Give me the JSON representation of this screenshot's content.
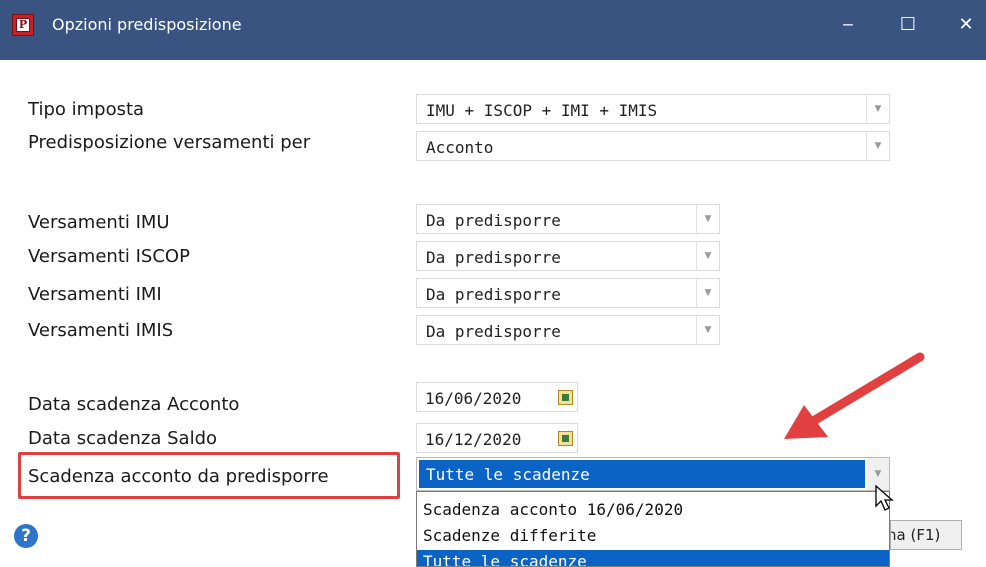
{
  "window": {
    "title": "Opzioni predisposizione",
    "app_icon_letter": "P",
    "minimize_glyph": "‒",
    "maximize_glyph": "☐",
    "close_glyph": "✕"
  },
  "form": {
    "tipo_imposta": {
      "label": "Tipo imposta",
      "value": "IMU + ISCOP + IMI + IMIS"
    },
    "predisposizione": {
      "label": "Predisposizione versamenti per",
      "value": "Acconto"
    },
    "versamenti": [
      {
        "label": "Versamenti IMU",
        "value": "Da predisporre"
      },
      {
        "label": "Versamenti ISCOP",
        "value": "Da predisporre"
      },
      {
        "label": "Versamenti IMI",
        "value": "Da predisporre"
      },
      {
        "label": "Versamenti IMIS",
        "value": "Da predisporre"
      }
    ],
    "data_acconto": {
      "label": "Data scadenza Acconto",
      "value": "16/06/2020"
    },
    "data_saldo": {
      "label": "Data scadenza Saldo",
      "value": "16/12/2020"
    },
    "scadenza_acconto": {
      "label": "Scadenza acconto da predisporre",
      "value": "Tutte le scadenze",
      "options": [
        "Scadenza acconto 16/06/2020",
        "Scadenze differite",
        "Tutte le scadenze"
      ],
      "selected_index": 2
    }
  },
  "footer": {
    "help_icon": "?",
    "help_button_label": "na (F1)"
  },
  "colors": {
    "titlebar": "#3a5482",
    "selection": "#0b63c5",
    "annotation": "#e04040"
  },
  "icons": {
    "arrow_icon": "chevron-down-icon",
    "calendar_icon": "calendar-icon",
    "annotation_arrow": "red-arrow-icon"
  }
}
